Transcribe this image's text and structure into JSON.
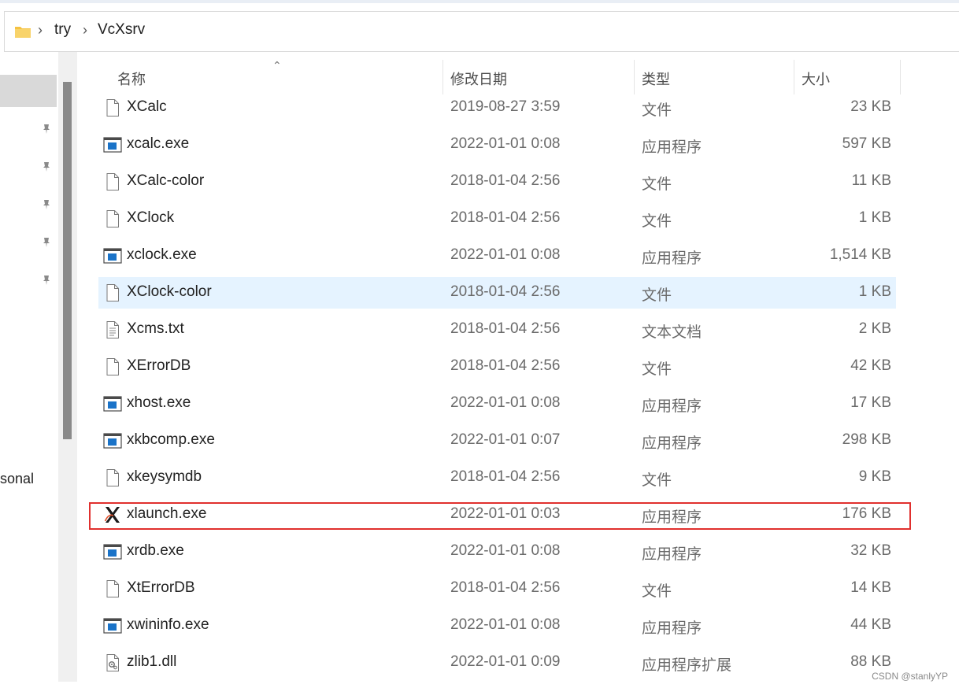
{
  "breadcrumb": [
    "try",
    "VcXsrv"
  ],
  "nav": {
    "partial_label": "sonal"
  },
  "columns": {
    "name": "名称",
    "modified": "修改日期",
    "type": "类型",
    "size": "大小"
  },
  "files": [
    {
      "name": "XCalc",
      "modified": "2019-08-27 3:59",
      "type": "文件",
      "size": "23 KB",
      "icon": "file-icon"
    },
    {
      "name": "xcalc.exe",
      "modified": "2022-01-01 0:08",
      "type": "应用程序",
      "size": "597 KB",
      "icon": "exe-icon"
    },
    {
      "name": "XCalc-color",
      "modified": "2018-01-04 2:56",
      "type": "文件",
      "size": "11 KB",
      "icon": "file-icon"
    },
    {
      "name": "XClock",
      "modified": "2018-01-04 2:56",
      "type": "文件",
      "size": "1 KB",
      "icon": "file-icon"
    },
    {
      "name": "xclock.exe",
      "modified": "2022-01-01 0:08",
      "type": "应用程序",
      "size": "1,514 KB",
      "icon": "exe-icon"
    },
    {
      "name": "XClock-color",
      "modified": "2018-01-04 2:56",
      "type": "文件",
      "size": "1 KB",
      "icon": "file-icon"
    },
    {
      "name": "Xcms.txt",
      "modified": "2018-01-04 2:56",
      "type": "文本文档",
      "size": "2 KB",
      "icon": "text-file-icon"
    },
    {
      "name": "XErrorDB",
      "modified": "2018-01-04 2:56",
      "type": "文件",
      "size": "42 KB",
      "icon": "file-icon"
    },
    {
      "name": "xhost.exe",
      "modified": "2022-01-01 0:08",
      "type": "应用程序",
      "size": "17 KB",
      "icon": "exe-icon"
    },
    {
      "name": "xkbcomp.exe",
      "modified": "2022-01-01 0:07",
      "type": "应用程序",
      "size": "298 KB",
      "icon": "exe-icon"
    },
    {
      "name": "xkeysymdb",
      "modified": "2018-01-04 2:56",
      "type": "文件",
      "size": "9 KB",
      "icon": "file-icon"
    },
    {
      "name": "xlaunch.exe",
      "modified": "2022-01-01 0:03",
      "type": "应用程序",
      "size": "176 KB",
      "icon": "xlaunch-icon"
    },
    {
      "name": "xrdb.exe",
      "modified": "2022-01-01 0:08",
      "type": "应用程序",
      "size": "32 KB",
      "icon": "exe-icon"
    },
    {
      "name": "XtErrorDB",
      "modified": "2018-01-04 2:56",
      "type": "文件",
      "size": "14 KB",
      "icon": "file-icon"
    },
    {
      "name": "xwininfo.exe",
      "modified": "2022-01-01 0:08",
      "type": "应用程序",
      "size": "44 KB",
      "icon": "exe-icon"
    },
    {
      "name": "zlib1.dll",
      "modified": "2022-01-01 0:09",
      "type": "应用程序扩展",
      "size": "88 KB",
      "icon": "dll-icon"
    }
  ],
  "hovered_file": "XClock-color",
  "highlighted_file": "xlaunch.exe",
  "watermark": "CSDN @stanlyYP",
  "colors": {
    "hover": "#e5f3ff",
    "highlight_border": "#e0302e",
    "exe_blue": "#1a73c8",
    "folder": "#f5c242"
  }
}
